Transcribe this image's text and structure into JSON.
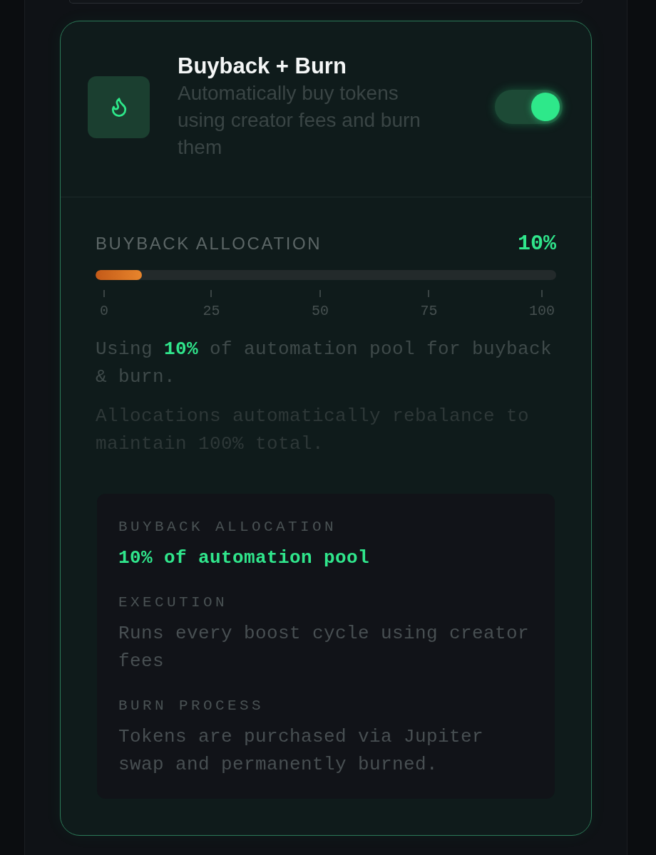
{
  "feature_card": {
    "title": "Buyback + Burn",
    "description": "Automatically buy tokens using creator fees and burn them",
    "toggle": {
      "on": true
    }
  },
  "allocation": {
    "label": "BUYBACK ALLOCATION",
    "value": "10%",
    "slider": {
      "level": 0.1
    },
    "ticks": [
      "0",
      "25",
      "50",
      "75",
      "100"
    ],
    "summary": "Using **10%** of automation pool for buyback & burn.",
    "note": "Allocations automatically rebalance to maintain 100% total."
  },
  "details": [
    {
      "label": "BUYBACK ALLOCATION",
      "value": "10% of automation pool",
      "kind": "emphasis"
    },
    {
      "label": "EXECUTION",
      "value": "Runs every boost cycle using creator fees",
      "kind": "plain"
    },
    {
      "label": "BURN PROCESS",
      "value": "Tokens are purchased via Jupiter swap and permanently burned.",
      "kind": "plain"
    }
  ]
}
